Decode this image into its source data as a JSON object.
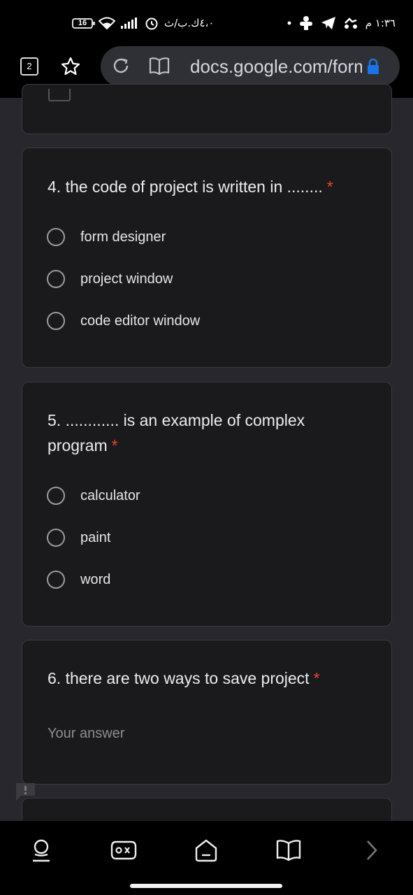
{
  "status_bar": {
    "battery": "16",
    "left_text": "٤،٠ك.ب/ث",
    "right_time": "١:٣٦ م",
    "icons_left": [
      "wifi-icon",
      "signal-icon",
      "alarm-icon"
    ],
    "icons_right": [
      "dot-icon",
      "game-icon",
      "telegram-icon",
      "delivery-icon"
    ]
  },
  "browser": {
    "tab_count": "2",
    "url": "docs.google.com/forms",
    "colors": {
      "lock": "#1a73e8"
    }
  },
  "questions": [
    {
      "title": "4. the code of project is written in ........",
      "required_mark": "*",
      "options": [
        "form designer",
        "project window",
        "code editor window"
      ]
    },
    {
      "title": "5. ............ is an example of complex program",
      "required_mark": "*",
      "options": [
        "calculator",
        "paint",
        "word"
      ]
    },
    {
      "title": "6. there are two ways to save project",
      "required_mark": "*",
      "answer_placeholder": "Your answer"
    }
  ],
  "bottom_nav": [
    "profile-icon",
    "gamepad-icon",
    "home-icon",
    "book-icon",
    "forward-icon"
  ],
  "colors": {
    "background": "#28272d",
    "card": "#1a1a1c",
    "required": "#ea4335"
  }
}
